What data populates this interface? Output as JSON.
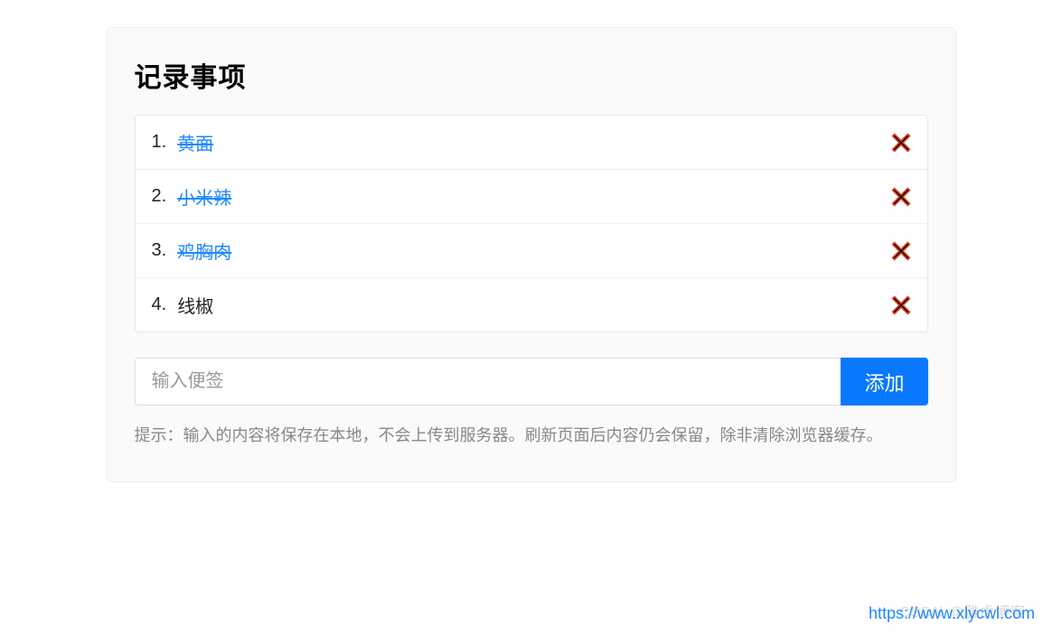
{
  "card": {
    "title": "记录事项",
    "items": [
      {
        "num": "1.",
        "text": "黄面",
        "done": true
      },
      {
        "num": "2.",
        "text": "小米辣",
        "done": true
      },
      {
        "num": "3.",
        "text": "鸡胸肉",
        "done": true
      },
      {
        "num": "4.",
        "text": "线椒",
        "done": false
      }
    ],
    "input_placeholder": "输入便签",
    "add_label": "添加",
    "hint": "提示：输入的内容将保存在本地，不会上传到服务器。刷新页面后内容仍会保留，除非清除浏览器缓存。"
  },
  "watermark_faint": "CSDN @雅虎博客",
  "watermark": "https://www.xlycwl.com"
}
